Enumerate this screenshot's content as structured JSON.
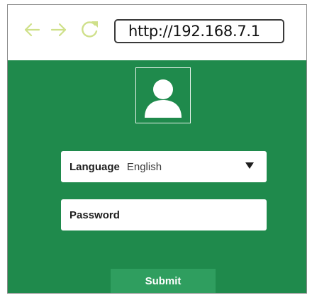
{
  "browser": {
    "url": "http://192.168.7.1"
  },
  "icons": {
    "back": "back-arrow-icon",
    "forward": "forward-arrow-icon",
    "reload": "reload-icon",
    "user": "user-avatar-icon",
    "dropdown": "dropdown-caret-icon"
  },
  "login": {
    "language": {
      "label": "Language",
      "value": "English"
    },
    "password": {
      "label": "Password"
    },
    "submit_label": "Submit"
  },
  "colors": {
    "page_background": "#1f8a4c",
    "submit_button": "#2f9e5f",
    "nav_icons": "#cfe08a"
  }
}
